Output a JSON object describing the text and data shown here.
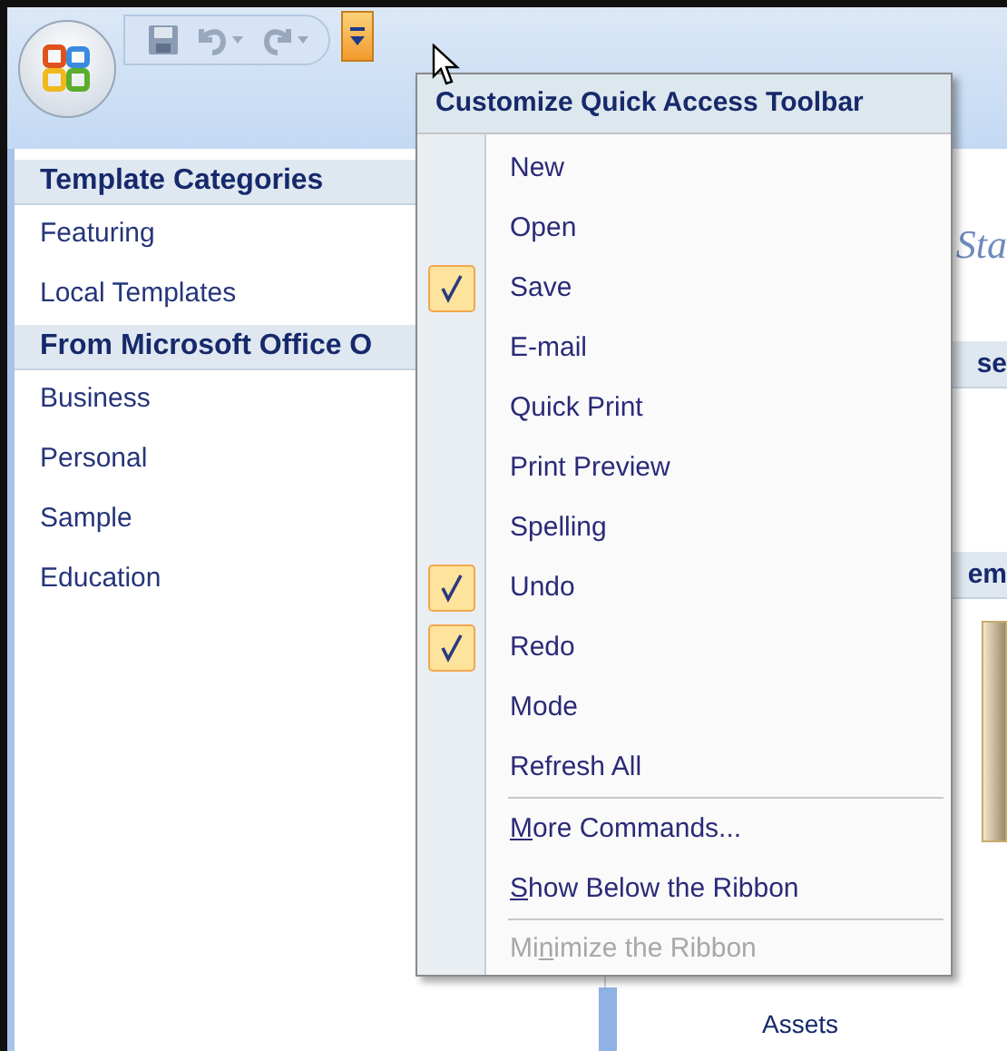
{
  "sidebar": {
    "sections": [
      {
        "title": "Template Categories",
        "items": [
          "Featuring",
          "Local Templates"
        ]
      },
      {
        "title": "From Microsoft Office O",
        "items": [
          "Business",
          "Personal",
          "Sample",
          "Education"
        ]
      }
    ]
  },
  "main": {
    "heading": "Sta",
    "panel_1_title": "se",
    "panel_2_title": "em",
    "caption": "Assets"
  },
  "menu": {
    "title": "Customize Quick Access Toolbar",
    "sections": [
      [
        {
          "label": "New",
          "checked": false
        },
        {
          "label": "Open",
          "checked": false
        },
        {
          "label": "Save",
          "checked": true
        },
        {
          "label": "E-mail",
          "checked": false
        },
        {
          "label": "Quick Print",
          "checked": false
        },
        {
          "label": "Print Preview",
          "checked": false
        },
        {
          "label": "Spelling",
          "checked": false
        },
        {
          "label": "Undo",
          "checked": true
        },
        {
          "label": "Redo",
          "checked": true
        },
        {
          "label": "Mode",
          "checked": false
        },
        {
          "label": "Refresh All",
          "checked": false
        }
      ],
      [
        {
          "key": "M",
          "after": "ore Commands...",
          "disabled": false
        },
        {
          "key": "S",
          "after": "how Below the Ribbon",
          "disabled": false
        }
      ],
      [
        {
          "before": "Mi",
          "key": "n",
          "after": "imize the Ribbon",
          "disabled": true
        }
      ]
    ]
  }
}
